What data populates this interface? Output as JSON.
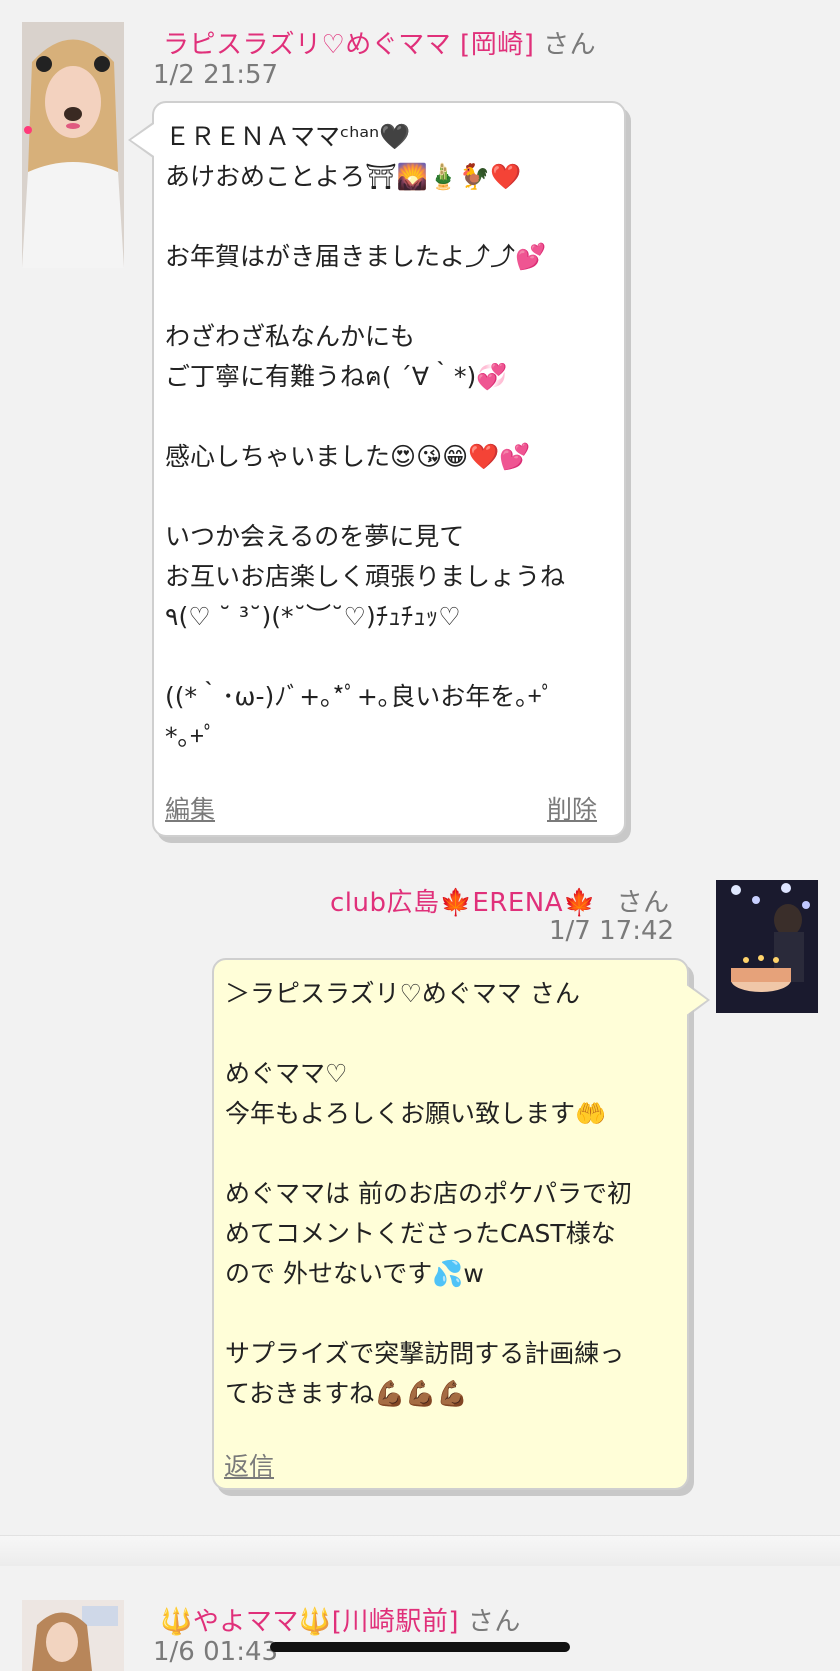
{
  "colors": {
    "name_pink": "#e0307a",
    "meta_gray": "#7a7a7a",
    "bubble_white": "#ffffff",
    "bubble_yellow": "#fffed8",
    "background": "#f2f2f2"
  },
  "messages": [
    {
      "sender": "ラピスラズリ♡めぐママ [岡崎]",
      "honorific": "さん",
      "time": "1/2 21:57",
      "body": "ＥＲＥＮＡママᶜʰᵃⁿ🖤\nあけおめことよろ⛩🌄🎍🐓❤️\n\nお年賀はがき届きましたよ⤴︎⤴︎💕\n\nわざわざ私なんかにも\nご丁寧に有難うねฅ( ´∀｀*)💞\n\n感心しちゃいました😍😘😁❤️💕\n\nいつか会えるのを夢に見て\nお互いお店楽しく頑張りましょうね\n٩(♡ ˘ ³˘)(*˘︶˘♡)ﾁｭﾁｭｯ♡\n\n((*｀･ω-)ﾉﾞ+｡*ﾟ+｡良いお年を｡+ﾟ\n*｡+ﾟ",
      "actions": {
        "edit": "編集",
        "delete": "削除"
      },
      "avatar_icon": "woman-photo-avatar"
    },
    {
      "sender": "club広島🍁ERENA🍁",
      "honorific": "さん",
      "time": "1/7 17:42",
      "body": "＞ラピスラズリ♡めぐママ さん\n\nめぐママ♡\n今年もよろしくお願い致します🤲\n\nめぐママは 前のお店のポケパラで初\nめてコメントくださったCAST様な\nので 外せないです💦w\n\nサプライズで突撃訪問する計画練っ\nておきますね💪🏾💪🏾💪🏾",
      "actions": {
        "reply": "返信"
      },
      "avatar_icon": "birthday-cake-photo-avatar"
    },
    {
      "sender": "🔱やよママ🔱[川崎駅前]",
      "honorific": "さん",
      "time": "1/6 01:43",
      "avatar_icon": "woman-portrait-avatar"
    }
  ]
}
